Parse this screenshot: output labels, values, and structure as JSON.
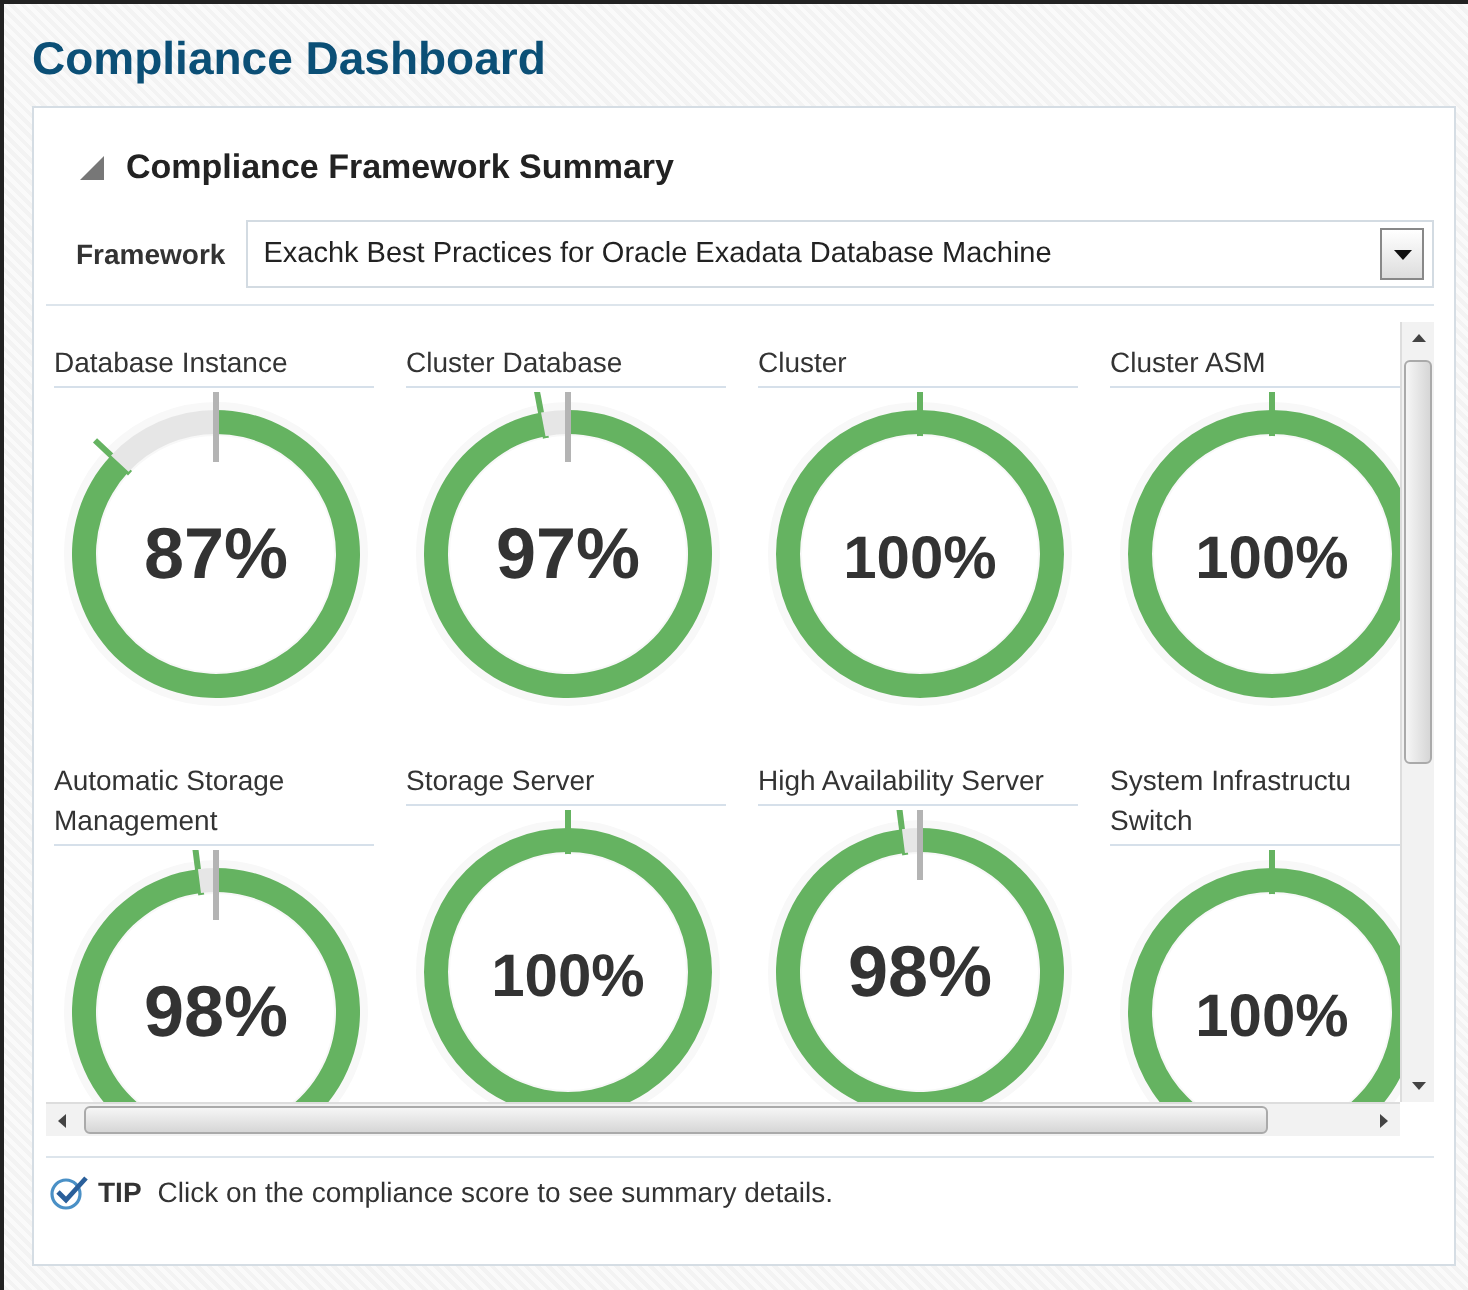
{
  "page": {
    "title": "Compliance Dashboard"
  },
  "panel": {
    "title": "Compliance Framework Summary",
    "expanded": true
  },
  "framework": {
    "label": "Framework",
    "value": "Exachk Best Practices for Oracle Exadata Database Machine"
  },
  "gauges": [
    {
      "title": "Database Instance",
      "value": "87%",
      "chart_data": {
        "type": "donut",
        "values": [
          87,
          13
        ]
      }
    },
    {
      "title": "Cluster Database",
      "value": "97%",
      "chart_data": {
        "type": "donut",
        "values": [
          97,
          3
        ]
      }
    },
    {
      "title": "Cluster",
      "value": "100%",
      "chart_data": {
        "type": "donut",
        "values": [
          100,
          0
        ]
      }
    },
    {
      "title": "Cluster ASM",
      "value": "100%",
      "chart_data": {
        "type": "donut",
        "values": [
          100,
          0
        ]
      }
    },
    {
      "title": "Automatic Storage Management",
      "value": "98%",
      "chart_data": {
        "type": "donut",
        "values": [
          98,
          2
        ]
      }
    },
    {
      "title": "Storage Server",
      "value": "100%",
      "chart_data": {
        "type": "donut",
        "values": [
          100,
          0
        ]
      }
    },
    {
      "title": "High Availability Server",
      "value": "98%",
      "chart_data": {
        "type": "donut",
        "values": [
          98,
          2
        ]
      }
    },
    {
      "title": "System Infrastructu Switch",
      "value": "100%",
      "chart_data": {
        "type": "donut",
        "values": [
          100,
          0
        ]
      }
    }
  ],
  "tip": {
    "label": "TIP",
    "text": "Click on the compliance score to see summary details."
  }
}
